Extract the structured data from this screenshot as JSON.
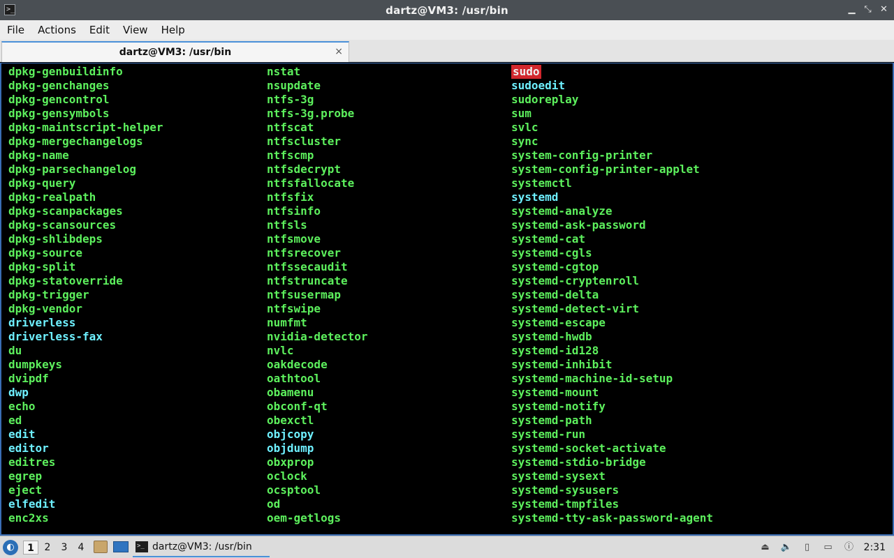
{
  "window": {
    "title": "dartz@VM3: /usr/bin",
    "controls": [
      "minimize",
      "maximize",
      "close"
    ]
  },
  "menu": [
    "File",
    "Actions",
    "Edit",
    "View",
    "Help"
  ],
  "tab": {
    "label": "dartz@VM3: /usr/bin",
    "close_symbol": "×"
  },
  "terminal": {
    "columns": [
      [
        {
          "name": "dpkg-genbuildinfo",
          "type": "exec"
        },
        {
          "name": "dpkg-genchanges",
          "type": "exec"
        },
        {
          "name": "dpkg-gencontrol",
          "type": "exec"
        },
        {
          "name": "dpkg-gensymbols",
          "type": "exec"
        },
        {
          "name": "dpkg-maintscript-helper",
          "type": "exec"
        },
        {
          "name": "dpkg-mergechangelogs",
          "type": "exec"
        },
        {
          "name": "dpkg-name",
          "type": "exec"
        },
        {
          "name": "dpkg-parsechangelog",
          "type": "exec"
        },
        {
          "name": "dpkg-query",
          "type": "exec"
        },
        {
          "name": "dpkg-realpath",
          "type": "exec"
        },
        {
          "name": "dpkg-scanpackages",
          "type": "exec"
        },
        {
          "name": "dpkg-scansources",
          "type": "exec"
        },
        {
          "name": "dpkg-shlibdeps",
          "type": "exec"
        },
        {
          "name": "dpkg-source",
          "type": "exec"
        },
        {
          "name": "dpkg-split",
          "type": "exec"
        },
        {
          "name": "dpkg-statoverride",
          "type": "exec"
        },
        {
          "name": "dpkg-trigger",
          "type": "exec"
        },
        {
          "name": "dpkg-vendor",
          "type": "exec"
        },
        {
          "name": "driverless",
          "type": "link"
        },
        {
          "name": "driverless-fax",
          "type": "link"
        },
        {
          "name": "du",
          "type": "exec"
        },
        {
          "name": "dumpkeys",
          "type": "exec"
        },
        {
          "name": "dvipdf",
          "type": "exec"
        },
        {
          "name": "dwp",
          "type": "link"
        },
        {
          "name": "echo",
          "type": "exec"
        },
        {
          "name": "ed",
          "type": "exec"
        },
        {
          "name": "edit",
          "type": "link"
        },
        {
          "name": "editor",
          "type": "link"
        },
        {
          "name": "editres",
          "type": "exec"
        },
        {
          "name": "egrep",
          "type": "exec"
        },
        {
          "name": "eject",
          "type": "exec"
        },
        {
          "name": "elfedit",
          "type": "link"
        },
        {
          "name": "enc2xs",
          "type": "exec"
        }
      ],
      [
        {
          "name": "nstat",
          "type": "exec"
        },
        {
          "name": "nsupdate",
          "type": "exec"
        },
        {
          "name": "ntfs-3g",
          "type": "exec"
        },
        {
          "name": "ntfs-3g.probe",
          "type": "exec"
        },
        {
          "name": "ntfscat",
          "type": "exec"
        },
        {
          "name": "ntfscluster",
          "type": "exec"
        },
        {
          "name": "ntfscmp",
          "type": "exec"
        },
        {
          "name": "ntfsdecrypt",
          "type": "exec"
        },
        {
          "name": "ntfsfallocate",
          "type": "exec"
        },
        {
          "name": "ntfsfix",
          "type": "exec"
        },
        {
          "name": "ntfsinfo",
          "type": "exec"
        },
        {
          "name": "ntfsls",
          "type": "exec"
        },
        {
          "name": "ntfsmove",
          "type": "exec"
        },
        {
          "name": "ntfsrecover",
          "type": "exec"
        },
        {
          "name": "ntfssecaudit",
          "type": "exec"
        },
        {
          "name": "ntfstruncate",
          "type": "exec"
        },
        {
          "name": "ntfsusermap",
          "type": "exec"
        },
        {
          "name": "ntfswipe",
          "type": "exec"
        },
        {
          "name": "numfmt",
          "type": "exec"
        },
        {
          "name": "nvidia-detector",
          "type": "exec"
        },
        {
          "name": "nvlc",
          "type": "exec"
        },
        {
          "name": "oakdecode",
          "type": "exec"
        },
        {
          "name": "oathtool",
          "type": "exec"
        },
        {
          "name": "obamenu",
          "type": "exec"
        },
        {
          "name": "obconf-qt",
          "type": "exec"
        },
        {
          "name": "obexctl",
          "type": "exec"
        },
        {
          "name": "objcopy",
          "type": "link"
        },
        {
          "name": "objdump",
          "type": "link"
        },
        {
          "name": "obxprop",
          "type": "exec"
        },
        {
          "name": "oclock",
          "type": "exec"
        },
        {
          "name": "ocsptool",
          "type": "exec"
        },
        {
          "name": "od",
          "type": "exec"
        },
        {
          "name": "oem-getlogs",
          "type": "exec"
        }
      ],
      [
        {
          "name": "sudo",
          "type": "suid"
        },
        {
          "name": "sudoedit",
          "type": "link"
        },
        {
          "name": "sudoreplay",
          "type": "exec"
        },
        {
          "name": "sum",
          "type": "exec"
        },
        {
          "name": "svlc",
          "type": "exec"
        },
        {
          "name": "sync",
          "type": "exec"
        },
        {
          "name": "system-config-printer",
          "type": "exec"
        },
        {
          "name": "system-config-printer-applet",
          "type": "exec"
        },
        {
          "name": "systemctl",
          "type": "exec"
        },
        {
          "name": "systemd",
          "type": "link"
        },
        {
          "name": "systemd-analyze",
          "type": "exec"
        },
        {
          "name": "systemd-ask-password",
          "type": "exec"
        },
        {
          "name": "systemd-cat",
          "type": "exec"
        },
        {
          "name": "systemd-cgls",
          "type": "exec"
        },
        {
          "name": "systemd-cgtop",
          "type": "exec"
        },
        {
          "name": "systemd-cryptenroll",
          "type": "exec"
        },
        {
          "name": "systemd-delta",
          "type": "exec"
        },
        {
          "name": "systemd-detect-virt",
          "type": "exec"
        },
        {
          "name": "systemd-escape",
          "type": "exec"
        },
        {
          "name": "systemd-hwdb",
          "type": "exec"
        },
        {
          "name": "systemd-id128",
          "type": "exec"
        },
        {
          "name": "systemd-inhibit",
          "type": "exec"
        },
        {
          "name": "systemd-machine-id-setup",
          "type": "exec"
        },
        {
          "name": "systemd-mount",
          "type": "exec"
        },
        {
          "name": "systemd-notify",
          "type": "exec"
        },
        {
          "name": "systemd-path",
          "type": "exec"
        },
        {
          "name": "systemd-run",
          "type": "exec"
        },
        {
          "name": "systemd-socket-activate",
          "type": "exec"
        },
        {
          "name": "systemd-stdio-bridge",
          "type": "exec"
        },
        {
          "name": "systemd-sysext",
          "type": "exec"
        },
        {
          "name": "systemd-sysusers",
          "type": "exec"
        },
        {
          "name": "systemd-tmpfiles",
          "type": "exec"
        },
        {
          "name": "systemd-tty-ask-password-agent",
          "type": "exec"
        }
      ]
    ],
    "colors": {
      "exec": "#5df05d",
      "link": "#6ef0ff",
      "suid_bg": "#d2272d",
      "suid_fg": "#f0f0f0",
      "background": "#000000"
    }
  },
  "taskbar": {
    "workspaces": [
      "1",
      "2",
      "3",
      "4"
    ],
    "active_workspace": "1",
    "task_label": "dartz@VM3: /usr/bin",
    "clock": "2:31",
    "tray_icons": [
      "usb-icon",
      "volume-icon",
      "clipboard-icon",
      "network-icon",
      "update-icon"
    ]
  }
}
